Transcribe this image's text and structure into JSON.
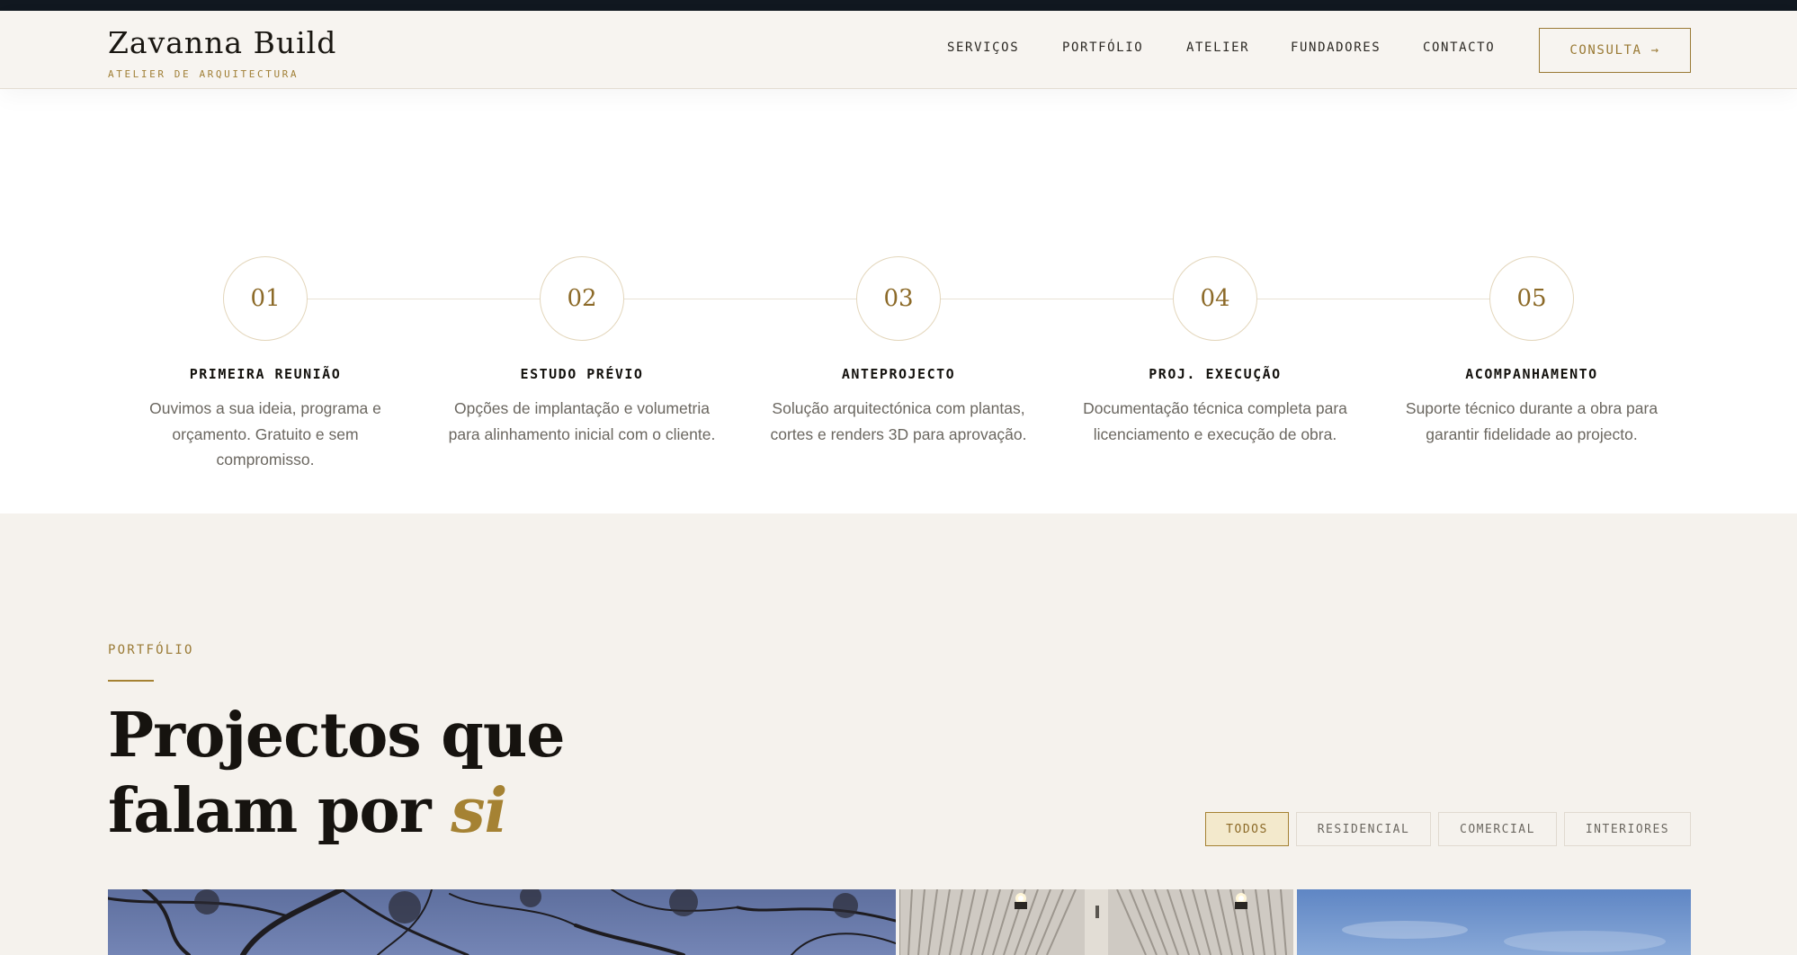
{
  "header": {
    "brand_name": "Zavanna Build",
    "brand_tagline": "ATELIER DE ARQUITECTURA",
    "nav": [
      "SERVIÇOS",
      "PORTFÓLIO",
      "ATELIER",
      "FUNDADORES",
      "CONTACTO"
    ],
    "cta_label": "CONSULTA →"
  },
  "process": {
    "steps": [
      {
        "number": "01",
        "title": "PRIMEIRA REUNIÃO",
        "description": "Ouvimos a sua ideia, programa e orçamento. Gratuito e sem compromisso."
      },
      {
        "number": "02",
        "title": "ESTUDO PRÉVIO",
        "description": "Opções de implantação e volumetria para alinhamento inicial com o cliente."
      },
      {
        "number": "03",
        "title": "ANTEPROJECTO",
        "description": "Solução arquitectónica com plantas, cortes e renders 3D para aprovação."
      },
      {
        "number": "04",
        "title": "PROJ. EXECUÇÃO",
        "description": "Documentação técnica completa para licenciamento e execução de obra."
      },
      {
        "number": "05",
        "title": "ACOMPANHAMENTO",
        "description": "Suporte técnico durante a obra para garantir fidelidade ao projecto."
      }
    ]
  },
  "portfolio": {
    "eyebrow": "PORTFÓLIO",
    "headline_line1": "Projectos que",
    "headline_line2": "falam por ",
    "headline_accent": "si",
    "filters": [
      "TODOS",
      "RESIDENCIAL",
      "COMERCIAL",
      "INTERIORES"
    ],
    "active_filter": "TODOS",
    "images": [
      "tree-dusk-photo",
      "ceiling-interior-photo",
      "sky-photo"
    ]
  },
  "colors": {
    "accent": "#a58233",
    "dark_strip": "#111820",
    "cream_bg": "#f5f2ed"
  }
}
